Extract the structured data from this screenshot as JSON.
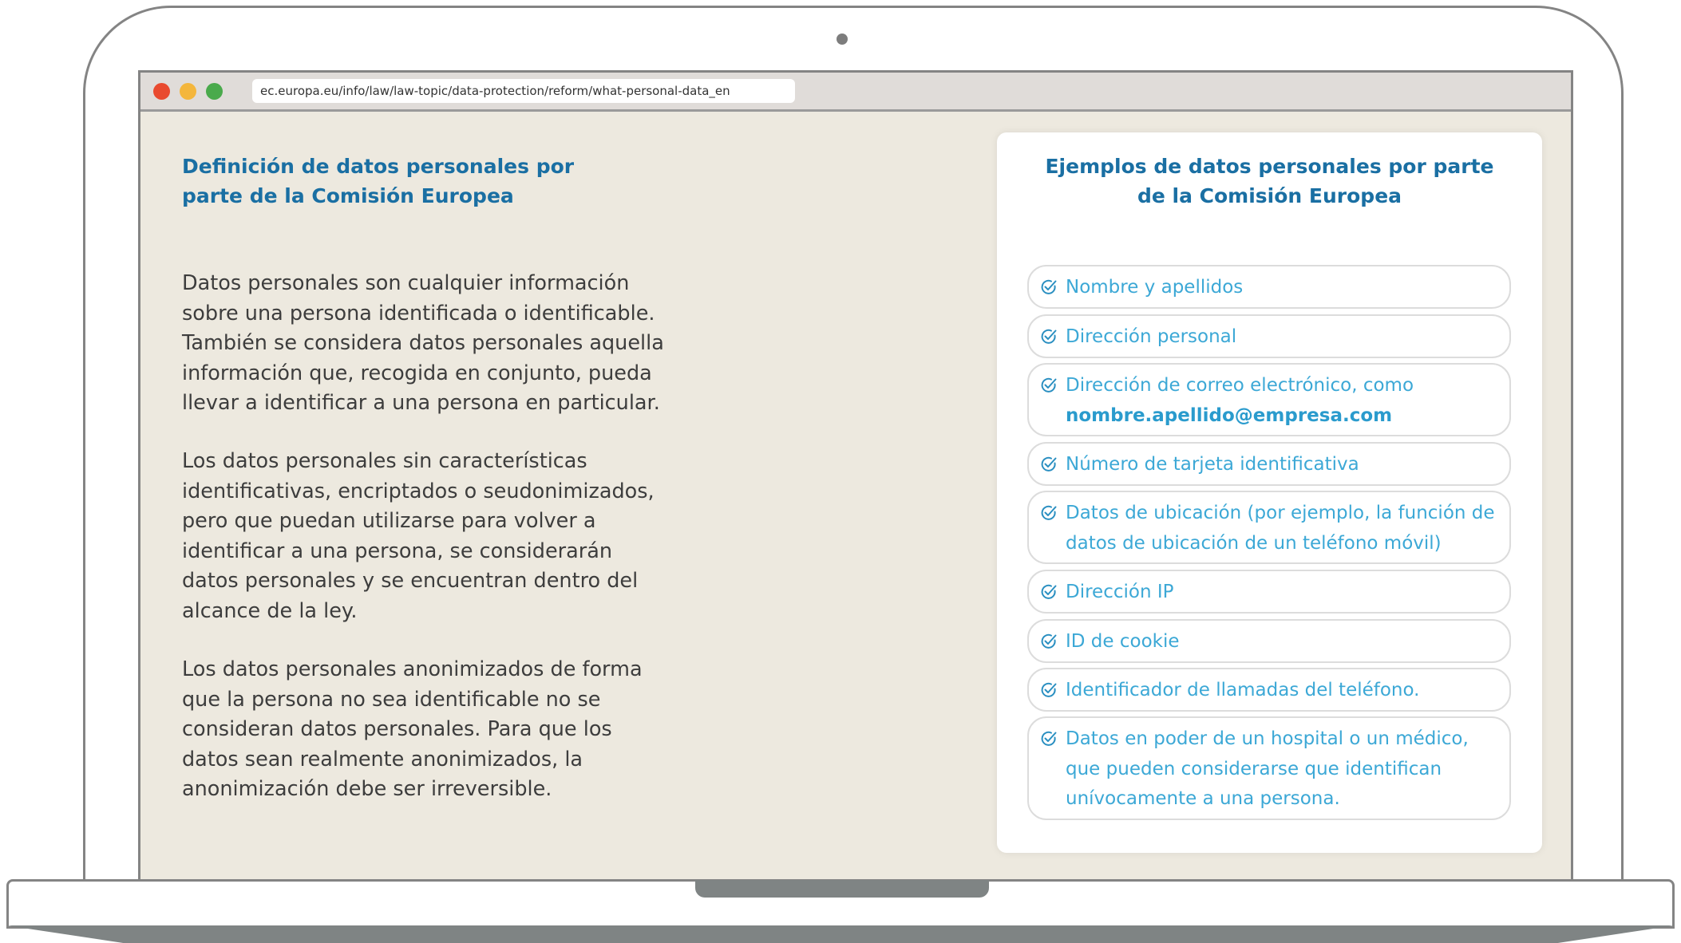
{
  "browser": {
    "url": "ec.europa.eu/info/law/law-topic/data-protection/reform/what-personal-data_en"
  },
  "left": {
    "title_line1": "Definición de datos personales por",
    "title_line2": "parte de la Comisión Europea",
    "paragraphs": [
      [
        "Datos personales son cualquier información",
        "sobre una persona identificada o identificable.",
        "También se considera datos personales aquella",
        "información que, recogida en conjunto, pueda",
        "llevar a identificar a una persona en particular."
      ],
      [
        "Los datos personales sin características",
        "identificativas, encriptados o seudonimizados,",
        "pero que puedan utilizarse para volver a",
        "identificar a una persona, se considerarán",
        "datos personales y se encuentran dentro del",
        "alcance de la ley."
      ],
      [
        "Los datos personales anonimizados de forma",
        "que la persona no sea identificable no se",
        "consideran datos personales. Para que los",
        "datos sean realmente anonimizados, la",
        "anonimización debe ser irreversible."
      ]
    ]
  },
  "card": {
    "title_line1": "Ejemplos de datos personales por parte",
    "title_line2": "de la Comisión Europea",
    "items": [
      {
        "lines": [
          "Nombre y apellidos"
        ]
      },
      {
        "lines": [
          "Dirección personal"
        ]
      },
      {
        "lines": [
          "Dirección de correo electrónico, como"
        ],
        "strong": "nombre.apellido@empresa.com"
      },
      {
        "lines": [
          "Número de tarjeta identificativa"
        ]
      },
      {
        "lines": [
          "Datos de ubicación (por ejemplo, la función de",
          "datos de ubicación de un teléfono móvil)"
        ]
      },
      {
        "lines": [
          "Dirección IP"
        ]
      },
      {
        "lines": [
          "ID de cookie"
        ]
      },
      {
        "lines": [
          "Identificador de llamadas del teléfono."
        ]
      },
      {
        "lines": [
          "Datos en poder de un hospital o un médico,",
          "que pueden considerarse que identifican",
          "unívocamente a una persona."
        ]
      }
    ],
    "icon": "check-circle-icon"
  },
  "colors": {
    "accent": "#1a6fa3",
    "item_text": "#3ca8d6",
    "screen_bg": "#ede9df"
  }
}
